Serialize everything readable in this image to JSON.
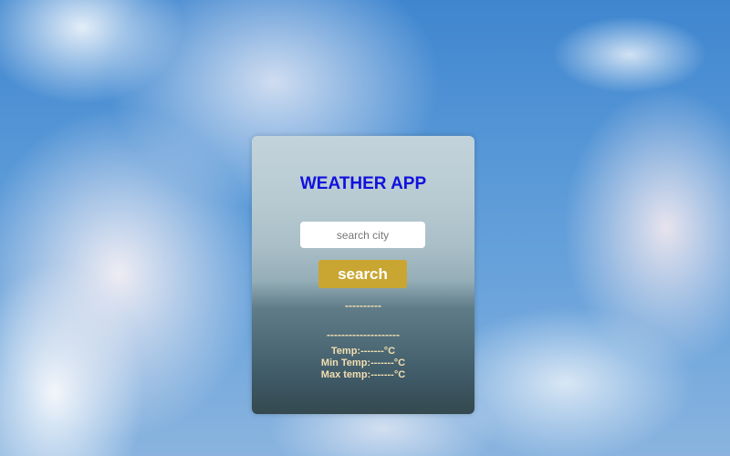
{
  "app": {
    "title": "WEATHER APP"
  },
  "search": {
    "placeholder": "search city",
    "value": "",
    "button_label": "search"
  },
  "weather": {
    "city": "----------",
    "description": "--------------------",
    "temp": "Temp:-------°C",
    "min_temp": "Min Temp:-------°C",
    "max_temp": "Max temp:-------°C"
  },
  "colors": {
    "title": "#1111dd",
    "button": "#c9a632",
    "result_text": "#f3dfb0"
  }
}
